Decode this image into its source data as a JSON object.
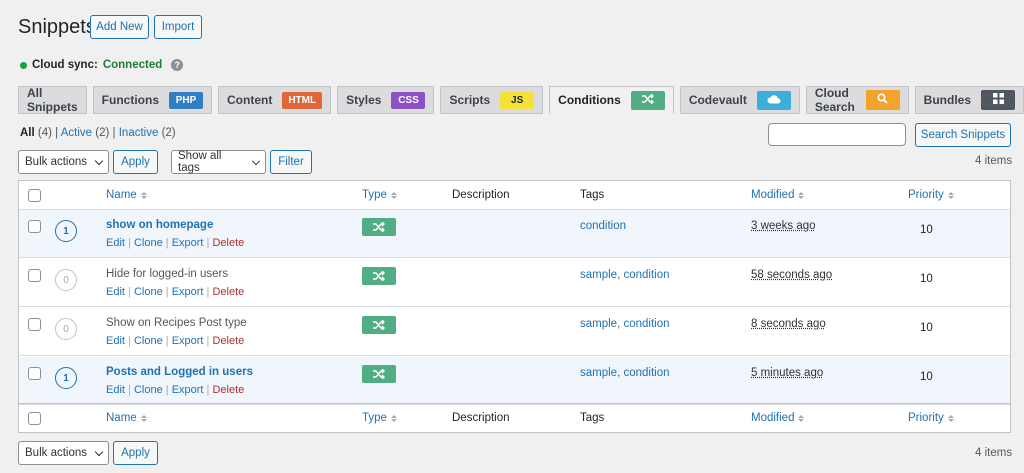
{
  "page": {
    "title": "Snippets",
    "add_new": "Add New",
    "import": "Import"
  },
  "sync": {
    "label": "Cloud sync:",
    "status": "Connected",
    "help_icon": "question-icon",
    "help_glyph": "?"
  },
  "tabs": [
    {
      "label": "All Snippets",
      "badge": "",
      "color": ""
    },
    {
      "label": "Functions",
      "badge": "PHP",
      "color": "#2e7fc4"
    },
    {
      "label": "Content",
      "badge": "HTML",
      "color": "#e0673a"
    },
    {
      "label": "Styles",
      "badge": "CSS",
      "color": "#8a52c4"
    },
    {
      "label": "Scripts",
      "badge": "JS",
      "color": "#f4e13a"
    },
    {
      "label": "Conditions",
      "badge": "",
      "color": "#50ad84",
      "icon": "shuffle-icon"
    },
    {
      "label": "Codevault",
      "badge": "",
      "color": "#3bafd9",
      "icon": "cloud-icon"
    },
    {
      "label": "Cloud Search",
      "badge": "",
      "color": "#f4a32c",
      "icon": "search-icon"
    },
    {
      "label": "Bundles",
      "badge": "",
      "color": "#50575e",
      "icon": "grid-icon"
    }
  ],
  "filters": {
    "all": "All",
    "all_count": "(4)",
    "active": "Active",
    "active_count": "(2)",
    "inactive": "Inactive",
    "inactive_count": "(2)",
    "sep": "|"
  },
  "search": {
    "button": "Search Snippets",
    "value": ""
  },
  "toolbar": {
    "bulk": "Bulk actions",
    "apply": "Apply",
    "tags": "Show all tags",
    "filter": "Filter",
    "items": "4 items"
  },
  "columns": {
    "name": "Name",
    "type": "Type",
    "description": "Description",
    "tags": "Tags",
    "modified": "Modified",
    "priority": "Priority"
  },
  "row_actions": {
    "edit": "Edit",
    "clone": "Clone",
    "export": "Export",
    "delete": "Delete",
    "sep": "|"
  },
  "rows": [
    {
      "order": "1",
      "name": "show on homepage",
      "tag1": "condition",
      "tag2": "",
      "modified": "3 weeks ago",
      "priority": "10",
      "active": true
    },
    {
      "order": "0",
      "name": "Hide for logged-in users",
      "tag1": "sample",
      "tag2": "condition",
      "modified": "58 seconds ago",
      "priority": "10",
      "active": false
    },
    {
      "order": "0",
      "name": "Show on Recipes Post type",
      "tag1": "sample",
      "tag2": "condition",
      "modified": "8 seconds ago",
      "priority": "10",
      "active": false
    },
    {
      "order": "1",
      "name": "Posts and Logged in users",
      "tag1": "sample",
      "tag2": "condition",
      "modified": "5 minutes ago",
      "priority": "10",
      "active": true
    }
  ],
  "bottom": {
    "bulk": "Bulk actions",
    "apply": "Apply",
    "items": "4 items"
  }
}
